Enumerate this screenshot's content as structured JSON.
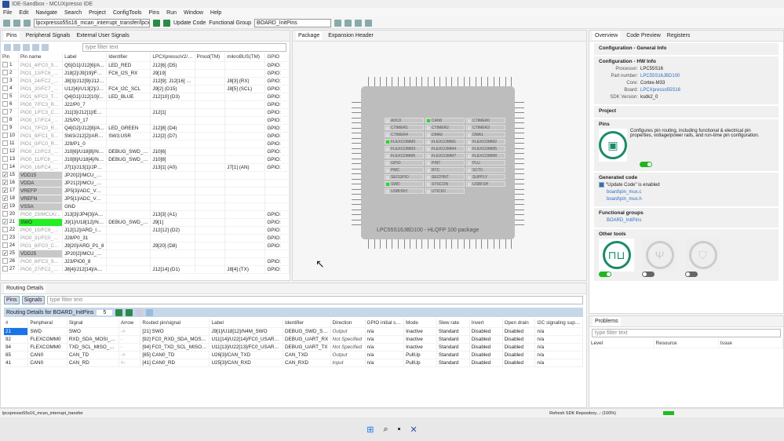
{
  "window": {
    "title": "IDE-Sandbox - MCUXpresso IDE"
  },
  "menu": [
    "File",
    "Edit",
    "Navigate",
    "Search",
    "Project",
    "ConfigTools",
    "Pins",
    "Run",
    "Window",
    "Help"
  ],
  "toolbar": {
    "project": "lpcxpresso55s16_mcan_interrupt_transfer/lpcxpresso",
    "update_code": "Update Code",
    "functional_group_label": "Functional Group",
    "functional_group": "BOARD_InitPins"
  },
  "pins_panel": {
    "tabs": [
      "Pins",
      "Peripheral Signals",
      "External User Signals"
    ],
    "filter_placeholder": "type filter text",
    "columns": [
      "Pin",
      "Pin name",
      "Label",
      "Identifier",
      "LPCXpressoV2/V...",
      "Pmod(TM)",
      "mikroBUS(TM)",
      "GPIO"
    ],
    "rows": [
      [
        "1",
        "PIO1_4/FC0_SCK...",
        "Q5[G1]/J12[6]/A...",
        "LED_RED",
        "J12[6] (D5)",
        "",
        "",
        "GPIO:",
        "n"
      ],
      [
        "2",
        "PIO1_13/FC6_RX...",
        "J18[2]/J9[19]/FC6...",
        "FC6_I2S_RX",
        "J9[19]",
        "",
        "",
        "GPIO:",
        "n"
      ],
      [
        "3",
        "PIO1_24/FC2_RX...",
        "J8[3]/J12[9]/J12[1...",
        "",
        "J12[9]; J12[16] (D...",
        "",
        "J8[3] (RX)",
        "GPIO:",
        "n"
      ],
      [
        "4",
        "PIO1_20/FC7_RT...",
        "U12[4]/U13[2]/J8...",
        "FC4_I2C_SCL",
        "J9[2] (D15)",
        "",
        "J8[5] (SCL)",
        "GPIO:",
        "n"
      ],
      [
        "5",
        "PIO1_6/FC0_TXD...",
        "Q4[G1]/J12[10]/...",
        "LED_BLUE",
        "J12[10] (D3)",
        "",
        "",
        "GPIO:",
        "n"
      ],
      [
        "6",
        "PIO0_7/FC3_RTS...",
        "J22/P0_7",
        "",
        "",
        "",
        "",
        "GPIO:",
        "n"
      ],
      [
        "7",
        "PIO0_1/FC3_CTS...",
        "J11[3]/J12[1]/EXP...",
        "",
        "J12[1]",
        "",
        "",
        "GPIO:",
        "n"
      ],
      [
        "8",
        "PIO0_17/FC4_SS...",
        "J25/P0_17",
        "",
        "",
        "",
        "",
        "GPIO:",
        "n"
      ],
      [
        "9",
        "PIO1_7/FC0_RTS...",
        "Q4[G2]/J12[8]/A...",
        "LED_GREEN",
        "J12[8] (D4)",
        "",
        "",
        "GPIO:",
        "n"
      ],
      [
        "10",
        "PIO1_9/FC1_SCK...",
        "SW3/J12[2]/ARD...",
        "SW3;USR",
        "J12[2] (D7)",
        "",
        "",
        "GPIO:",
        "n"
      ],
      [
        "11",
        "PIO1_0/FC0_RTS...",
        "J29/P1_0",
        "",
        "",
        "",
        "",
        "GPIO:",
        "n"
      ],
      [
        "12",
        "PIO0_12/FC3_TX...",
        "J10[6]/U18[8]/N4...",
        "DEBUG_SWD_S...",
        "J10[6]",
        "",
        "",
        "GPIO:",
        "n"
      ],
      [
        "13",
        "PIO0_11/FC6_RX...",
        "J10[8]/U18[4]/N4...",
        "DEBUG_SWD_S...",
        "J10[8]",
        "",
        "",
        "GPIO:",
        "n"
      ],
      [
        "14",
        "PIO0_16/FC4_TX...",
        "J7[1]/J13[1]/JP4[...",
        "",
        "J13[1] (A0)",
        "",
        "J7[1] (AN)",
        "GPIO:",
        "n"
      ],
      [
        "15",
        "VDD15",
        "JP20[2]/MCU_VDD",
        "",
        "",
        "",
        "",
        "",
        "p"
      ],
      [
        "16",
        "VDDA",
        "JP21[2]/MCU_VD...",
        "",
        "",
        "",
        "",
        "",
        "p"
      ],
      [
        "17",
        "VREFP",
        "JP5[3]/ADC_VREFP",
        "",
        "",
        "",
        "",
        "",
        "p"
      ],
      [
        "18",
        "VREFN",
        "JP5[1]/ADC_VRE...",
        "",
        "",
        "",
        "",
        "",
        "p"
      ],
      [
        "19",
        "VSSA",
        "GND",
        "",
        "",
        "",
        "",
        "",
        "p"
      ],
      [
        "20",
        "PIO0_23/MCLK/...",
        "J13[3]/JP4[3]/AR...",
        "",
        "J13[3] (A1)",
        "",
        "",
        "GPIO:",
        "n"
      ],
      [
        "21",
        "SWO",
        "J9[1]/U18[12]/N4...",
        "DEBUG_SWD_S...",
        "J9[1]",
        "",
        "",
        "GPIO:",
        "s"
      ],
      [
        "22",
        "PIO0_15/FC6_CT...",
        "J12[12]/ARD_INT...",
        "",
        "J12[12] (D2)",
        "",
        "",
        "GPIO:",
        "n"
      ],
      [
        "23",
        "PIO0_31/FC0_CT...",
        "J28/P0_31",
        "",
        "",
        "",
        "",
        "GPIO:",
        "n"
      ],
      [
        "24",
        "PIO1_8/FC0_CTS...",
        "J9[20]/ARD_P1_8",
        "",
        "J9[20] (D8)",
        "",
        "",
        "GPIO:",
        "n"
      ],
      [
        "25",
        "VDD25",
        "JP20[2]/MCU_VDD",
        "",
        "",
        "",
        "",
        "",
        "p"
      ],
      [
        "26",
        "PIO0_8/FC3_SSE...",
        "J23/PIO0_8",
        "",
        "",
        "",
        "",
        "GPIO:",
        "n"
      ],
      [
        "27",
        "PIO0_27/FC2_TX...",
        "J8[4]/J12[14]/AR...",
        "",
        "J12[14] (D1)",
        "",
        "J8[4] (TX)",
        "GPIO:",
        "n"
      ]
    ]
  },
  "package_panel": {
    "tabs": [
      "Package",
      "Expansion Header"
    ],
    "chip_label": "LPC55S16JBD100 - HLQFP 100 package",
    "peripherals": [
      [
        "ADC0",
        0
      ],
      [
        "CAN0",
        1
      ],
      [
        "CTIMER0",
        0
      ],
      [
        "CTIMER1",
        0
      ],
      [
        "CTIMER2",
        0
      ],
      [
        "CTIMER3",
        0
      ],
      [
        "CTIMER4",
        0
      ],
      [
        "DMA0",
        0
      ],
      [
        "DMA1",
        0
      ],
      [
        "FLEXCOMM0",
        1
      ],
      [
        "FLEXCOMM1",
        0
      ],
      [
        "FLEXCOMM2",
        0
      ],
      [
        "FLEXCOMM3",
        0
      ],
      [
        "FLEXCOMM4",
        0
      ],
      [
        "FLEXCOMM5",
        0
      ],
      [
        "FLEXCOMM6",
        0
      ],
      [
        "FLEXCOMM7",
        0
      ],
      [
        "FLEXCOMM8",
        0
      ],
      [
        "GPIO",
        0
      ],
      [
        "PINT",
        0
      ],
      [
        "PLU",
        0
      ],
      [
        "PMC",
        0
      ],
      [
        "RTC",
        0
      ],
      [
        "SCT0",
        0
      ],
      [
        "SECGPIO",
        0
      ],
      [
        "SECPINT",
        0
      ],
      [
        "SUPPLY",
        0
      ],
      [
        "SWD",
        1
      ],
      [
        "SYSCON",
        0
      ],
      [
        "USBFSH",
        0
      ],
      [
        "USBHSH",
        0
      ],
      [
        "UTICK0",
        0
      ]
    ]
  },
  "overview": {
    "tabs": [
      "Overview",
      "Code Preview",
      "Registers"
    ],
    "general_info": "Configuration - General Info",
    "hw_info": "Configuration - HW Info",
    "hw": [
      [
        "Processor:",
        "LPC55S16",
        false
      ],
      [
        "Part number:",
        "LPC55S16JBD100",
        true
      ],
      [
        "Core:",
        "Cortex-M33",
        false
      ],
      [
        "Board:",
        "LPCXpresso55S16",
        true
      ],
      [
        "SDK Version:",
        "ksdk2_0",
        false
      ]
    ],
    "project": "Project",
    "pins_title": "Pins",
    "pins_desc": "Configures pin routing, including functional & electrical pin properties, voltage/power rails, and run-time pin configuration.",
    "generated_code": "Generated code",
    "update_enabled": "\"Update Code\" is enabled",
    "files": [
      "board\\pin_mux.c",
      "board\\pin_mux.h"
    ],
    "functional_groups": "Functional groups",
    "group": "BOARD_InitPins",
    "other_tools": "Other tools"
  },
  "routing": {
    "title": "Routing Details",
    "btn_pins": "Pins",
    "btn_signals": "Signals",
    "filter_placeholder": "type filter text",
    "header_label": "Routing Details for BOARD_InitPins",
    "count": "5",
    "columns": [
      "#",
      "Peripheral",
      "Signal",
      "Arrow",
      "Routed pin/signal",
      "Label",
      "Identifier",
      "Direction",
      "GPIO initial state",
      "Mode",
      "Slew rate",
      "Invert",
      "Open drain",
      "I2C signaling supply"
    ],
    "rows": [
      [
        "21",
        "SWD",
        "SWO",
        "->",
        "[21] SWO",
        "J9[1]/U18[12]/N4M_SWO",
        "DEBUG_SWD_SWO",
        "Output",
        "n/a",
        "Inactive",
        "Standard",
        "Disabled",
        "Disabled",
        "n/a"
      ],
      [
        "92",
        "FLEXCOMM0",
        "RXD_SDA_MOSI_DATA",
        "-",
        "[92] FC0_RXD_SDA_MOSI_DATA",
        "U11[14]/U22[14]/FC0_USART_RXD",
        "DEBUG_UART_RX",
        "Not Specified",
        "n/a",
        "Inactive",
        "Standard",
        "Disabled",
        "Disabled",
        "n/a"
      ],
      [
        "94",
        "FLEXCOMM0",
        "TXD_SCL_MISO_WS",
        "-",
        "[94] FC0_TXD_SCL_MISO_WS",
        "U11[13]/U22[13]/FC0_USART_TXD",
        "DEBUG_UART_TX",
        "Not Specified",
        "n/a",
        "Inactive",
        "Standard",
        "Disabled",
        "Disabled",
        "n/a"
      ],
      [
        "85",
        "CAN0",
        "CAN_TD",
        "->",
        "[85] CAN0_TD",
        "U26[3]/CAN_TXD",
        "CAN_TXD",
        "Output",
        "n/a",
        "PullUp",
        "Standard",
        "Disabled",
        "Disabled",
        "n/a"
      ],
      [
        "41",
        "CAN0",
        "CAN_RD",
        "<-",
        "[41] CAN0_RD",
        "U25[3]/CAN_RXD",
        "CAN_RXD",
        "Input",
        "n/a",
        "PullUp",
        "Standard",
        "Disabled",
        "Disabled",
        "n/a"
      ]
    ]
  },
  "problems": {
    "title": "Problems",
    "filter_placeholder": "type filter text",
    "columns": [
      "Level",
      "Resource",
      "Issue"
    ]
  },
  "status": {
    "left": "lpcxpresso55s16_mcan_interrupt_transfer",
    "progress": "Refresh SDK Repository...: (100%)"
  }
}
